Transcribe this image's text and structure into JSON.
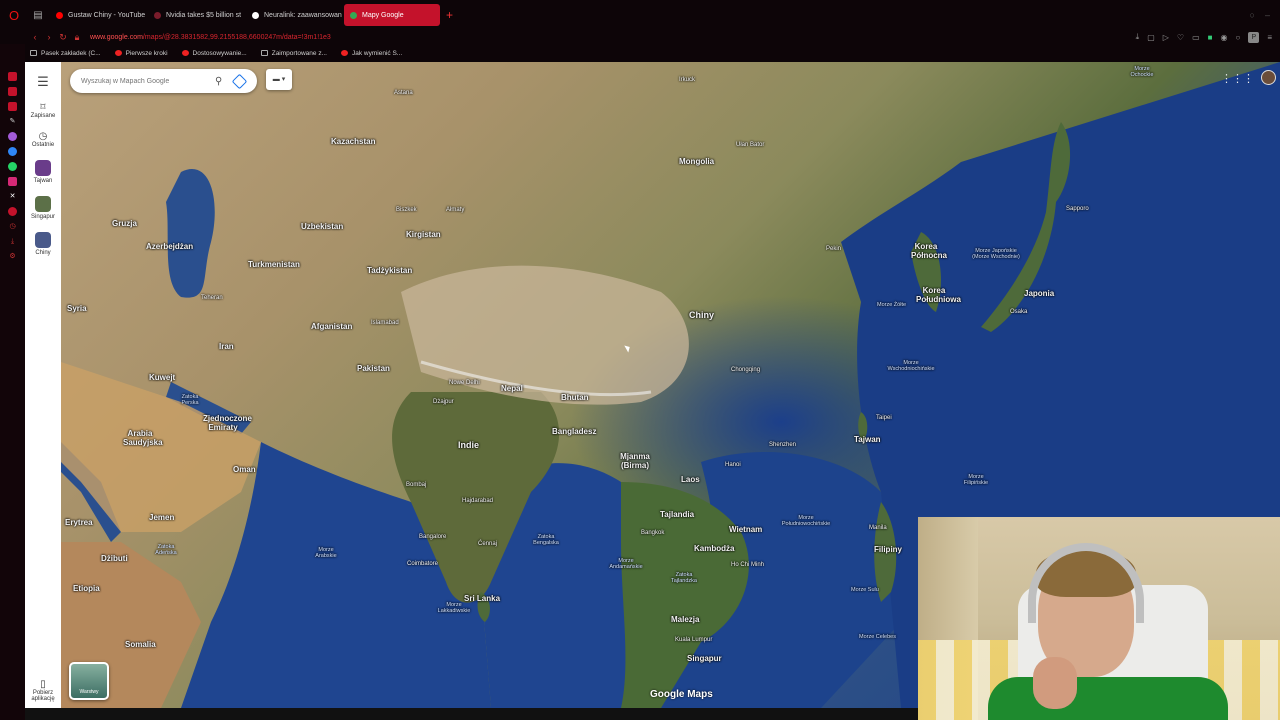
{
  "browser": {
    "tabs": [
      {
        "title": "Gustaw Chiny - YouTube",
        "favicon_color": "#ff0000",
        "active": false
      },
      {
        "title": "Nvidia takes $5 billion st",
        "favicon_color": "#7a1c2b",
        "active": false
      },
      {
        "title": "Neuralink: zaawansowan",
        "favicon_color": "#ffffff",
        "active": false
      },
      {
        "title": "Mapy Google",
        "favicon_color": "#34a853",
        "active": true
      }
    ],
    "new_tab_label": "+",
    "url_host": "www.google.com",
    "url_path": "/maps/@28.3831582,99.2155188,6600247m/data=!3m1!1e3",
    "bookmarks": [
      {
        "label": "Pasek zakładek (C...",
        "icon": "folder-icon"
      },
      {
        "label": "Pierwsze kroki",
        "icon": "bookmark-icon"
      },
      {
        "label": "Dostosowywanie...",
        "icon": "youtube-icon"
      },
      {
        "label": "Zaimportowane z...",
        "icon": "folder-icon"
      },
      {
        "label": "Jak wymienić S...",
        "icon": "youtube-icon"
      }
    ],
    "accent": "#c4122b",
    "profile_letter": "P"
  },
  "maps": {
    "search_placeholder": "Wyszukaj w Mapach Google",
    "sidebar": {
      "saved_label": "Zapisane",
      "recent_label": "Ostatnie",
      "recents": [
        {
          "label": "Tajwan",
          "thumb_color": "#6a3c8a"
        },
        {
          "label": "Singapur",
          "thumb_color": "#5c7048"
        },
        {
          "label": "Chiny",
          "thumb_color": "#4a5a8a"
        }
      ],
      "get_app_label": "Pobierz aplikację"
    },
    "layers_label": "Warstwy",
    "logo": "Google Maps",
    "places": [
      {
        "name": "Kazachstan",
        "kind": "country"
      },
      {
        "name": "Mongolia",
        "kind": "country"
      },
      {
        "name": "Chiny",
        "kind": "big"
      },
      {
        "name": "Indie",
        "kind": "big"
      },
      {
        "name": "Japonia",
        "kind": "country"
      },
      {
        "name": "Korea Północna",
        "kind": "country"
      },
      {
        "name": "Korea Południowa",
        "kind": "country"
      },
      {
        "name": "Uzbekistan",
        "kind": "country"
      },
      {
        "name": "Turkmenistan",
        "kind": "country"
      },
      {
        "name": "Kirgistan",
        "kind": "country"
      },
      {
        "name": "Tadżykistan",
        "kind": "country"
      },
      {
        "name": "Afganistan",
        "kind": "country"
      },
      {
        "name": "Pakistan",
        "kind": "country"
      },
      {
        "name": "Iran",
        "kind": "country"
      },
      {
        "name": "Azerbejdżan",
        "kind": "country"
      },
      {
        "name": "Gruzja",
        "kind": "country"
      },
      {
        "name": "Syria",
        "kind": "country"
      },
      {
        "name": "Kuwejt",
        "kind": "country"
      },
      {
        "name": "Arabia Saudyjska",
        "kind": "country"
      },
      {
        "name": "Zjednoczone Emiraty",
        "kind": "country"
      },
      {
        "name": "Oman",
        "kind": "country"
      },
      {
        "name": "Jemen",
        "kind": "country"
      },
      {
        "name": "Erytrea",
        "kind": "country"
      },
      {
        "name": "Dżibuti",
        "kind": "country"
      },
      {
        "name": "Etiopia",
        "kind": "country"
      },
      {
        "name": "Somalia",
        "kind": "country"
      },
      {
        "name": "Nepal",
        "kind": "country"
      },
      {
        "name": "Bhutan",
        "kind": "country"
      },
      {
        "name": "Bangladesz",
        "kind": "country"
      },
      {
        "name": "Mjanma (Birma)",
        "kind": "country"
      },
      {
        "name": "Laos",
        "kind": "country"
      },
      {
        "name": "Tajlandia",
        "kind": "country"
      },
      {
        "name": "Wietnam",
        "kind": "country"
      },
      {
        "name": "Kambodża",
        "kind": "country"
      },
      {
        "name": "Filipiny",
        "kind": "country"
      },
      {
        "name": "Malezja",
        "kind": "country"
      },
      {
        "name": "Singapur",
        "kind": "country"
      },
      {
        "name": "Sri Lanka",
        "kind": "country"
      },
      {
        "name": "Tajwan",
        "kind": "country"
      },
      {
        "name": "Astana",
        "kind": "city"
      },
      {
        "name": "Irkuck",
        "kind": "city"
      },
      {
        "name": "Ułan Bator",
        "kind": "city"
      },
      {
        "name": "Biszkek",
        "kind": "city"
      },
      {
        "name": "Ałmaty",
        "kind": "city"
      },
      {
        "name": "Islamabad",
        "kind": "city"
      },
      {
        "name": "Teheran",
        "kind": "city"
      },
      {
        "name": "Pekin",
        "kind": "city"
      },
      {
        "name": "Osaka",
        "kind": "city"
      },
      {
        "name": "Sapporo",
        "kind": "city"
      },
      {
        "name": "Chongqing",
        "kind": "city"
      },
      {
        "name": "Shenzhen",
        "kind": "city"
      },
      {
        "name": "Hanoi",
        "kind": "city"
      },
      {
        "name": "Nowe Delhi",
        "kind": "city"
      },
      {
        "name": "Dżajpur",
        "kind": "city"
      },
      {
        "name": "Bombaj",
        "kind": "city"
      },
      {
        "name": "Hajdarabad",
        "kind": "city"
      },
      {
        "name": "Bangalore",
        "kind": "city"
      },
      {
        "name": "Ćennaj",
        "kind": "city"
      },
      {
        "name": "Coimbatore",
        "kind": "city"
      },
      {
        "name": "Manila",
        "kind": "city"
      },
      {
        "name": "Kuala Lumpur",
        "kind": "city"
      },
      {
        "name": "Bangkok",
        "kind": "city"
      },
      {
        "name": "Ho Chi Minh",
        "kind": "city"
      },
      {
        "name": "Taipei",
        "kind": "city"
      },
      {
        "name": "Morze Arabskie",
        "kind": "sea"
      },
      {
        "name": "Morze Lakkadiwskie",
        "kind": "sea"
      },
      {
        "name": "Zatoka Bengalska",
        "kind": "sea"
      },
      {
        "name": "Morze Andamańskie",
        "kind": "sea"
      },
      {
        "name": "Morze Japońskie (Morze Wschodnie)",
        "kind": "sea"
      },
      {
        "name": "Morze Żółte",
        "kind": "sea"
      },
      {
        "name": "Morze Wschodniochińskie",
        "kind": "sea"
      },
      {
        "name": "Morze Filipińskie",
        "kind": "sea"
      },
      {
        "name": "Morze Południowochińskie",
        "kind": "sea"
      },
      {
        "name": "Morze Sulu",
        "kind": "sea"
      },
      {
        "name": "Morze Celebes",
        "kind": "sea"
      },
      {
        "name": "Morze Ochockie",
        "kind": "sea"
      },
      {
        "name": "Zatoka Perska",
        "kind": "sea"
      },
      {
        "name": "Zatoka Adeńska",
        "kind": "sea"
      },
      {
        "name": "Zatoka Tajlandzka",
        "kind": "sea"
      }
    ]
  },
  "colors": {
    "land": "#a8926a",
    "ocean": "#1c3f8a",
    "accent": "#c4122b"
  }
}
